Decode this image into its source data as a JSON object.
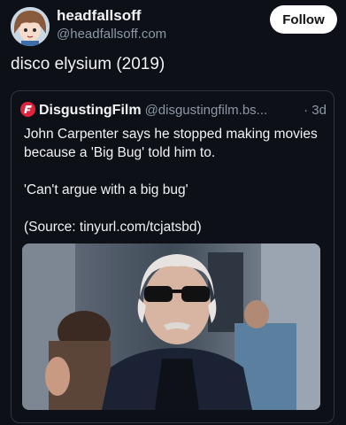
{
  "post": {
    "author_name": "headfallsoff",
    "author_handle": "@headfallsoff.com",
    "follow_label": "Follow",
    "text": "disco elysium (2019)"
  },
  "quote": {
    "author_name": "DisgustingFilm",
    "author_handle": "@disgustingfilm.bs...",
    "time": "· 3d",
    "lines": [
      "John Carpenter says he stopped making movies because a 'Big Bug' told him to.",
      "'Can't argue with a big bug'",
      "(Source: tinyurl.com/tcjatsbd)"
    ]
  },
  "colors": {
    "background": "#0d1017",
    "text": "#f1f3f5",
    "muted": "#8b98a5",
    "border": "#2f3640",
    "follow_bg": "#ffffff",
    "brand_red": "#e0243d"
  },
  "icons": {
    "avatar": "anime-avatar",
    "quote_source": "film-logo-icon"
  }
}
